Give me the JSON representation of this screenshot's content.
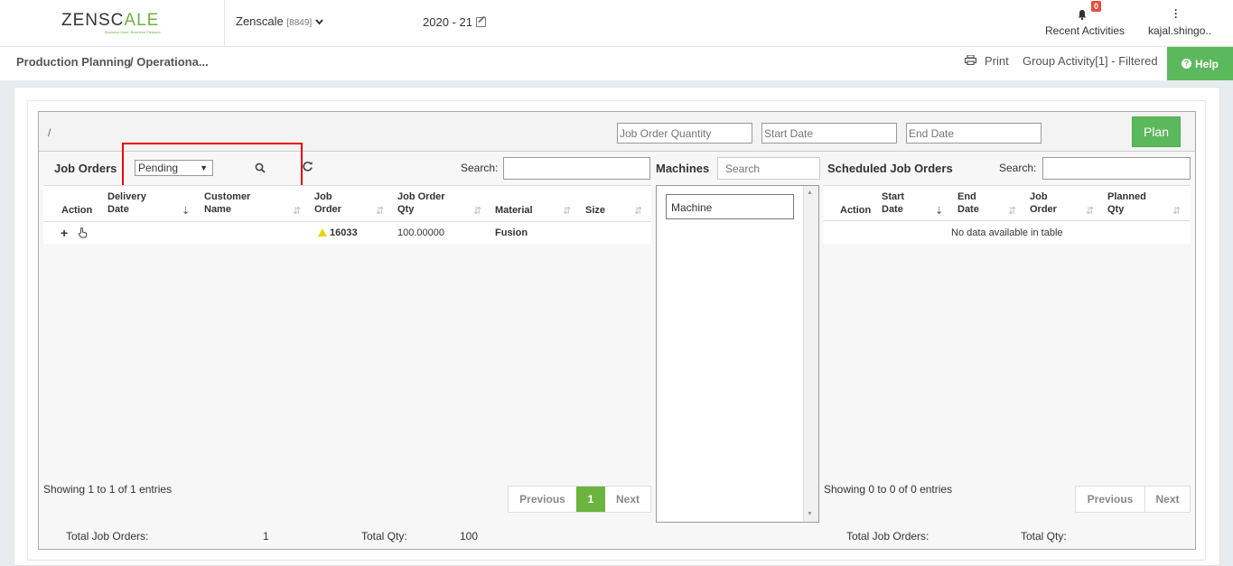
{
  "header": {
    "logo_main": "ZENSC",
    "logo_accent": "A",
    "logo_end": "LE",
    "logo_tagline": "Business Ease, Business Pleasure",
    "company": "Zenscale",
    "company_code": "[8849]",
    "financial_year": "2020 - 21",
    "notifications_count": "0",
    "recent_activities": "Recent Activities",
    "user": "kajal.shingo.."
  },
  "breadcrumb": {
    "root": "Production Planning",
    "current": "/ Operationa..."
  },
  "toolbar": {
    "print": "Print",
    "group_activity": "Group Activity[1] - Filtered",
    "help": "Help"
  },
  "filters": {
    "slash": "/",
    "job_order_quantity": "Job Order Quantity",
    "start_date": "Start Date",
    "end_date": "End Date",
    "plan": "Plan"
  },
  "job_orders": {
    "title": "Job Orders",
    "status": "Pending",
    "search_label": "Search:",
    "columns": {
      "action": "Action",
      "delivery_1": "Delivery",
      "delivery_2": "Date",
      "customer_1": "Customer",
      "customer_2": "Name",
      "job_1": "Job",
      "job_2": "Order",
      "qty_1": "Job Order",
      "qty_2": "Qty",
      "material": "Material",
      "size": "Size"
    },
    "rows": [
      {
        "job_order": "16033",
        "qty": "100.00000",
        "material": "Fusion"
      }
    ],
    "info": "Showing 1 to 1 of 1 entries",
    "previous": "Previous",
    "page": "1",
    "next": "Next",
    "total_label": "Total Job Orders:",
    "total_value": "1",
    "qty_label": "Total Qty:",
    "qty_value": "100"
  },
  "machines": {
    "title": "Machines",
    "search_placeholder": "Search",
    "items": [
      "Machine"
    ]
  },
  "scheduled": {
    "title": "Scheduled Job Orders",
    "search_label": "Search:",
    "columns": {
      "action": "Action",
      "start_1": "Start",
      "start_2": "Date",
      "end_1": "End",
      "end_2": "Date",
      "job_1": "Job",
      "job_2": "Order",
      "planned_1": "Planned",
      "planned_2": "Qty"
    },
    "empty": "No data available in table",
    "info": "Showing 0 to 0 of 0 entries",
    "previous": "Previous",
    "next": "Next",
    "total_label": "Total Job Orders:",
    "qty_label": "Total Qty:"
  }
}
